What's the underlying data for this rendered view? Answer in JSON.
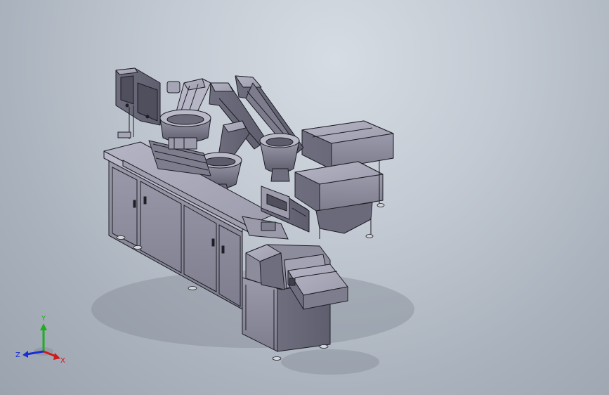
{
  "viewport": {
    "background_top": "#d6dce3",
    "background_bottom": "#9aa3ae"
  },
  "model": {
    "body_color": "#8c8c9c",
    "edge_color": "#1e1e26",
    "shadow_color": "#6f7782"
  },
  "triad": {
    "x_label": "X",
    "y_label": "Y",
    "z_label": "Z",
    "x_color": "#d11a1a",
    "y_color": "#1fae1f",
    "z_color": "#1a2fd1"
  }
}
